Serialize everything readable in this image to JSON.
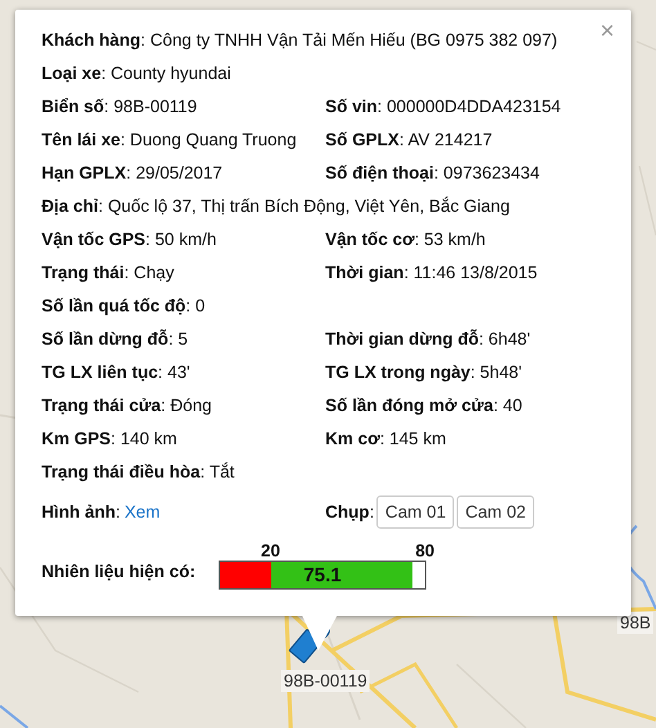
{
  "popup": {
    "close": "×",
    "rows": [
      [
        {
          "text": "**Khách hàng**: Công ty TNHH Vận Tải Mến Hiếu (BG 0975 382 097)"
        }
      ],
      [
        {
          "text": "**Loại xe**: County hyundai"
        }
      ],
      [
        {
          "text": "**Biển số**: 98B-00119"
        },
        {
          "text": "**Số vin**: 000000D4DDA423154"
        }
      ],
      [
        {
          "text": "**Tên lái xe**: Duong Quang Truong"
        },
        {
          "text": "**Số GPLX**: AV 214217"
        }
      ],
      [
        {
          "text": "**Hạn GPLX**: 29/05/2017"
        },
        {
          "text": "**Số điện thoại**: 0973623434"
        }
      ],
      [
        {
          "text": "**Địa chỉ**: Quốc lộ 37, Thị trấn Bích Động, Việt Yên, Bắc Giang"
        }
      ],
      [
        {
          "text": "**Vận tốc GPS**: 50 km/h"
        },
        {
          "text": "**Vận tốc cơ**: 53 km/h"
        }
      ],
      [
        {
          "text": "**Trạng thái**: Chạy"
        },
        {
          "text": "**Thời gian**: 11:46 13/8/2015"
        }
      ],
      [
        {
          "text": "**Số lần quá tốc độ**: 0"
        }
      ],
      [
        {
          "text": "**Số lần dừng đỗ**: 5"
        },
        {
          "text": "**Thời gian dừng đỗ**: 6h48'"
        }
      ],
      [
        {
          "text": "**TG LX liên tục**: 43'"
        },
        {
          "text": "**TG LX trong ngày**: 5h48'"
        }
      ],
      [
        {
          "text": "**Trạng thái cửa**: Đóng"
        },
        {
          "text": "**Số lần đóng mở cửa**: 40"
        }
      ],
      [
        {
          "text": "**Km GPS**: 140 km"
        },
        {
          "text": "**Km cơ**: 145 km"
        }
      ],
      [
        {
          "text": "**Trạng thái điều hòa**: Tắt"
        }
      ]
    ],
    "images": {
      "label": "**Hình ảnh**: ",
      "link": "Xem"
    },
    "capture": {
      "label": "**Chụp**:",
      "buttons": [
        "Cam 01",
        "Cam 02"
      ]
    },
    "fuel": {
      "label": "Nhiên liệu hiện có:",
      "threshold": {
        "label": "20",
        "level": 0.25
      },
      "max_label": "80",
      "reading": "75.1",
      "level": 0.939
    }
  },
  "markers": [
    {
      "label": "98B-00119"
    },
    {
      "label": "98B"
    }
  ]
}
